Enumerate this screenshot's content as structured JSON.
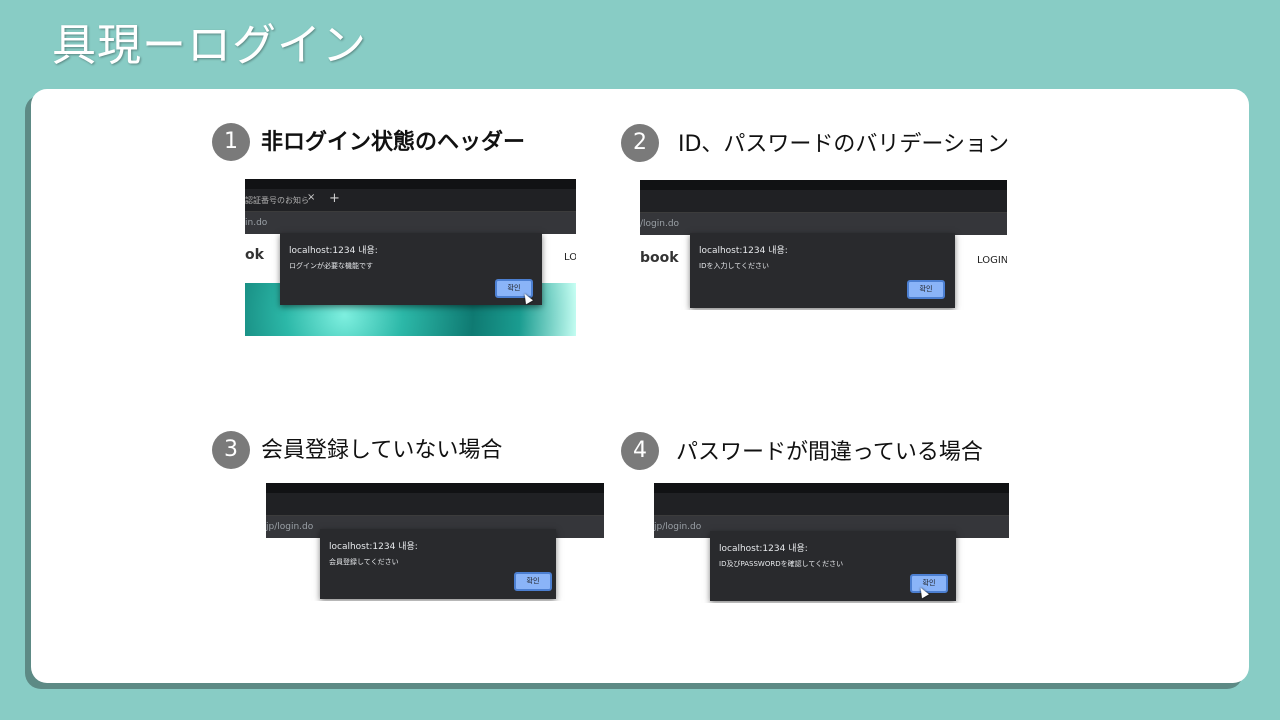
{
  "slide": {
    "title": "具現ーログイン"
  },
  "steps": [
    {
      "number": "1",
      "title": "非ログイン状態のヘッダー",
      "screenshot": {
        "tab_text": "認証番号のお知ら",
        "tab_close": "×",
        "tab_plus": "+",
        "url": "in.do",
        "logo": "ok",
        "login": "LO",
        "dialog_title": "localhost:1234 내용:",
        "dialog_message": "ログインが必要な機能です",
        "dialog_button": "확인"
      }
    },
    {
      "number": "2",
      "title": "ID、パスワードのバリデーション",
      "screenshot": {
        "url": "/login.do",
        "logo": "book",
        "login": "LOGIN",
        "dialog_title": "localhost:1234 내용:",
        "dialog_message": "IDを入力してください",
        "dialog_button": "확인"
      }
    },
    {
      "number": "3",
      "title": "会員登録していない場合",
      "screenshot": {
        "url": "jp/login.do",
        "dialog_title": "localhost:1234 내용:",
        "dialog_message": "会員登録してください",
        "dialog_button": "확인"
      }
    },
    {
      "number": "4",
      "title": "パスワードが間違っている場合",
      "screenshot": {
        "url": "jp/login.do",
        "dialog_title": "localhost:1234 내용:",
        "dialog_message": "ID及びPASSWORDを確認してください",
        "dialog_button": "확인"
      }
    }
  ],
  "colors": {
    "background": "#88ccc5",
    "card": "#ffffff",
    "badge": "#7a7a7a",
    "dialog": "#292a2d",
    "button": "#8ab4f8"
  }
}
